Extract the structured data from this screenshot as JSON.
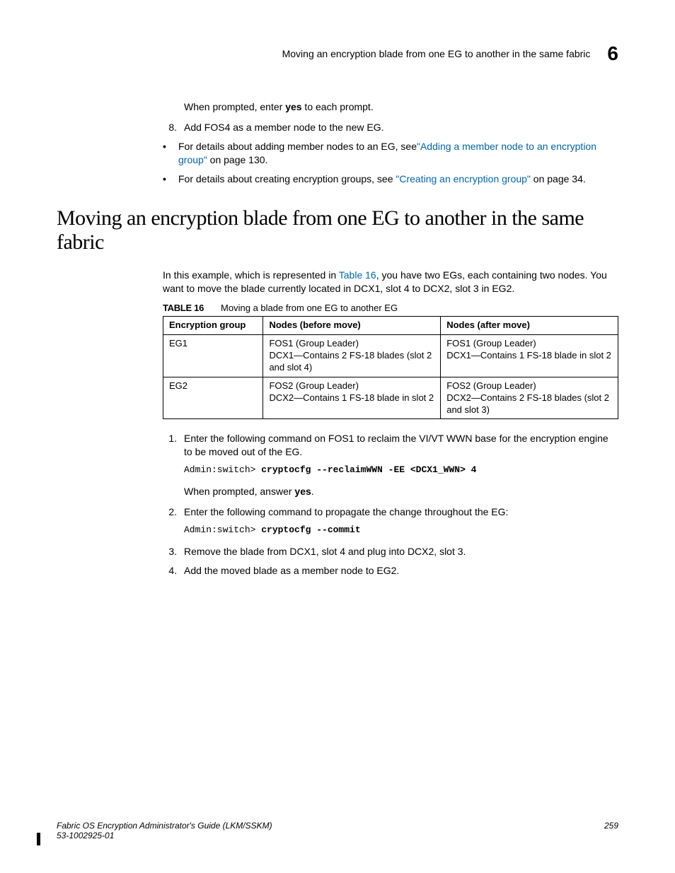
{
  "header": {
    "title": "Moving an encryption blade from one EG to another in the same fabric",
    "chapter": "6"
  },
  "intro": {
    "p_prompt": "When prompted, enter ",
    "p_prompt_bold": "yes",
    "p_prompt_tail": " to each prompt.",
    "step8_num": "8.",
    "step8_text": "Add FOS4 as a member node to the new EG.",
    "bullet1_a": "For details about adding member nodes to an EG, see",
    "bullet1_link": "\"Adding a member node to an encryption group\"",
    "bullet1_b": " on page 130.",
    "bullet2_a": "For details about creating encryption groups, see ",
    "bullet2_link": "\"Creating an encryption group\"",
    "bullet2_b": " on page 34."
  },
  "section": {
    "heading": "Moving an encryption blade from one EG to another in the same fabric",
    "intro_a": "In this example, which is represented in ",
    "intro_link": "Table 16",
    "intro_b": ", you have two EGs, each containing two nodes. You want to move the blade currently located in DCX1, slot 4 to DCX2, slot 3 in EG2."
  },
  "table": {
    "label": "TABLE 16",
    "caption": "Moving a blade from one EG to another EG",
    "head": {
      "c1": "Encryption group",
      "c2": "Nodes (before move)",
      "c3": "Nodes (after move)"
    },
    "rows": [
      {
        "c1": "EG1",
        "c2a": "FOS1 (Group Leader)",
        "c2b": "DCX1—Contains 2 FS-18 blades (slot 2 and slot 4)",
        "c3a": "FOS1 (Group Leader)",
        "c3b": "DCX1—Contains 1 FS-18 blade in slot 2"
      },
      {
        "c1": "EG2",
        "c2a": "FOS2 (Group Leader)",
        "c2b": "DCX2—Contains 1 FS-18 blade in slot 2",
        "c3a": "FOS2 (Group Leader)",
        "c3b": "DCX2—Contains 2 FS-18 blades (slot 2 and slot 3)"
      }
    ]
  },
  "steps": {
    "s1_num": "1.",
    "s1_text": "Enter the following command on FOS1 to reclaim the VI/VT WWN base for the encryption engine to be moved out of the EG.",
    "s1_code_a": "Admin:switch> ",
    "s1_code_b": "cryptocfg --reclaimWWN -EE <DCX1_WWN> 4",
    "s1_after_a": "When prompted, answer ",
    "s1_after_b": "yes",
    "s1_after_c": ".",
    "s2_num": "2.",
    "s2_text": "Enter the following command to propagate the change throughout the EG:",
    "s2_code_a": "Admin:switch> ",
    "s2_code_b": "cryptocfg --commit",
    "s3_num": "3.",
    "s3_text": "Remove the blade from DCX1, slot 4 and plug into DCX2, slot 3.",
    "s4_num": "4.",
    "s4_text": "Add the moved blade as a member node to EG2."
  },
  "footer": {
    "left1": "Fabric OS Encryption Administrator's Guide  (LKM/SSKM)",
    "left2": "53-1002925-01",
    "right": "259"
  }
}
